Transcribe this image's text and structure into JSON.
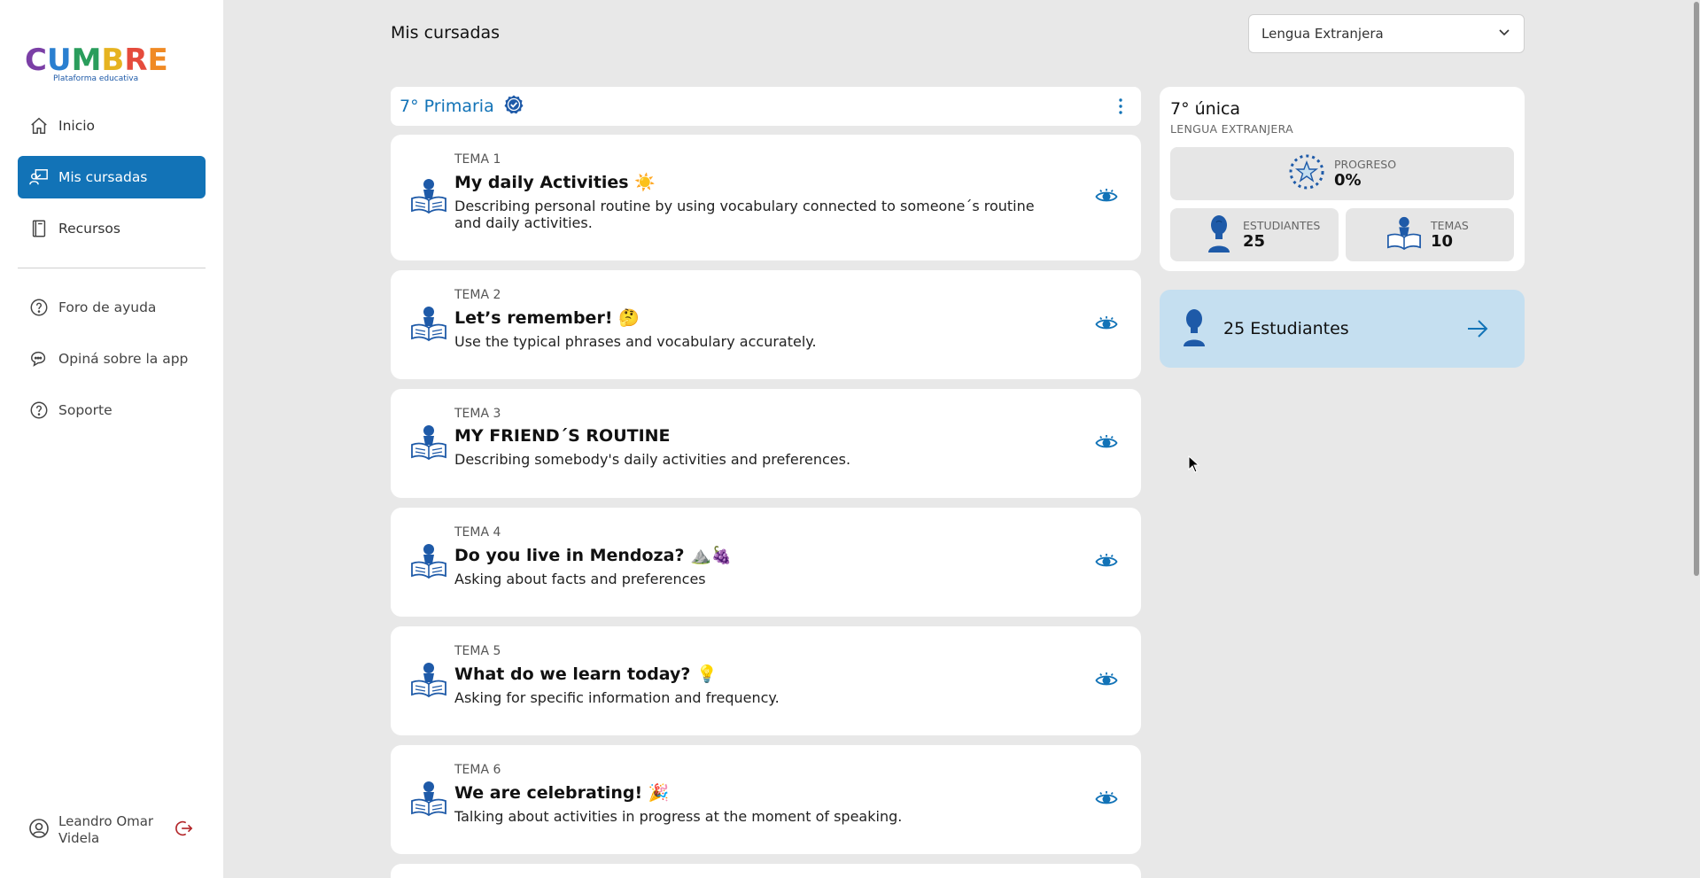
{
  "brand": {
    "logo_text": "CUMBRE",
    "tagline": "Plataforma educativa"
  },
  "sidebar": {
    "items": [
      {
        "label": "Inicio",
        "icon": "home-icon"
      },
      {
        "label": "Mis cursadas",
        "icon": "classroom-icon",
        "active": true
      },
      {
        "label": "Recursos",
        "icon": "book-icon"
      }
    ],
    "secondary": [
      {
        "label": "Foro de ayuda",
        "icon": "help-circle-icon"
      },
      {
        "label": "Opiná sobre la app",
        "icon": "chat-icon"
      },
      {
        "label": "Soporte",
        "icon": "help-circle-icon"
      }
    ],
    "user": {
      "name": "Leandro Omar Videla"
    }
  },
  "header": {
    "title": "Mis cursadas"
  },
  "subject_select": {
    "value": "Lengua Extranjera"
  },
  "course": {
    "title": "7° Primaria"
  },
  "topics": [
    {
      "num": "TEMA 1",
      "name": "My daily Activities ☀️",
      "desc": "Describing personal routine by using vocabulary connected to someone´s routine and daily activities."
    },
    {
      "num": "TEMA 2",
      "name": "Let’s remember! 🤔",
      "desc": "Use the typical phrases and vocabulary accurately."
    },
    {
      "num": "TEMA 3",
      "name": "MY FRIEND´S ROUTINE",
      "desc": "Describing somebody's daily activities and preferences."
    },
    {
      "num": "TEMA 4",
      "name": "Do you live in Mendoza? ⛰️🍇",
      "desc": "Asking about facts and preferences"
    },
    {
      "num": "TEMA 5",
      "name": "What do we learn today? 💡",
      "desc": "Asking for specific information and frequency."
    },
    {
      "num": "TEMA 6",
      "name": "We are celebrating! 🎉",
      "desc": "Talking about activities in progress at the moment of speaking."
    }
  ],
  "summary": {
    "title": "7° única",
    "subtitle": "LENGUA EXTRANJERA",
    "progress_label": "PROGRESO",
    "progress_value": "0%",
    "students_label": "ESTUDIANTES",
    "students_value": "25",
    "topics_label": "TEMAS",
    "topics_value": "10"
  },
  "students_link": {
    "label": "25 Estudiantes"
  },
  "colors": {
    "primary": "#1273b7",
    "accent_light": "#c5dff0",
    "background": "#e8e8e8"
  }
}
